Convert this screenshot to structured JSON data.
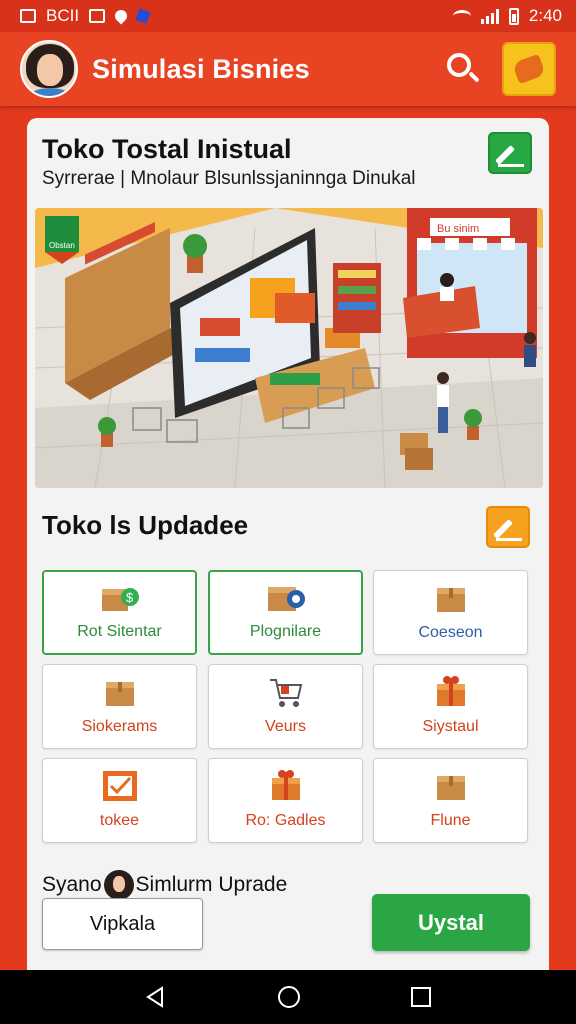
{
  "status_bar": {
    "left_text": "BCII",
    "time": "2:40",
    "icons": [
      "image-icon",
      "message-icon",
      "location-icon",
      "wifi-icon",
      "signal-icon",
      "battery-icon"
    ]
  },
  "app_bar": {
    "title": "Simulasi Bisnies",
    "icons": [
      "avatar",
      "search-icon",
      "hand-icon"
    ]
  },
  "shop": {
    "title": "Toko Tostal Inistual",
    "subtitle": "Syrrerae | Mnolaur  Blsunlssjaninnga Dinukal",
    "sign_text": "Bu sinim",
    "badge_text": "Obstan"
  },
  "updates": {
    "title": "Toko ls Updadee",
    "items": [
      {
        "label": "Rot Sitentar",
        "icon": "box-dollar-icon",
        "color": "#2d8a3a"
      },
      {
        "label": "Plognilare",
        "icon": "box-tape-icon",
        "color": "#2d8a3a"
      },
      {
        "label": "Coeseon",
        "icon": "box-icon",
        "color": "#2b5fa8"
      },
      {
        "label": "Siokerams",
        "icon": "box-icon",
        "color": "#d4421e"
      },
      {
        "label": "Veurs",
        "icon": "cart-icon",
        "color": "#d4421e"
      },
      {
        "label": "Siystaul",
        "icon": "gift-box-icon",
        "color": "#d4421e"
      },
      {
        "label": "tokee",
        "icon": "checkbox-icon",
        "color": "#d4421e"
      },
      {
        "label": "Ro: Gadles",
        "icon": "gift-box-icon",
        "color": "#d4421e"
      },
      {
        "label": "Flune",
        "icon": "box-icon",
        "color": "#d4421e"
      }
    ]
  },
  "footer": {
    "label_before": "Syano",
    "label_after": "Simlurm Uprade",
    "secondary_button": "Vipkala",
    "primary_button": "Uystal"
  },
  "colors": {
    "brand_red": "#e84323",
    "accent_green": "#2ba644",
    "accent_orange": "#f7a21e"
  }
}
